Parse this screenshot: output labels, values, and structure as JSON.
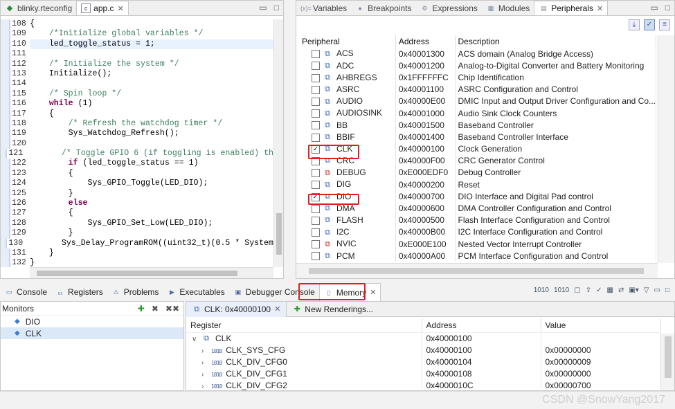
{
  "editor": {
    "tabs": [
      {
        "label": "blinky.rteconfig",
        "active": false
      },
      {
        "label": "app.c",
        "active": true
      }
    ],
    "lines": [
      {
        "n": "108",
        "t": "{"
      },
      {
        "n": "109",
        "t": "    /*Initialize global variables */",
        "c": "cm"
      },
      {
        "n": "110",
        "t": "    led_toggle_status = 1;",
        "hl": true
      },
      {
        "n": "111",
        "t": ""
      },
      {
        "n": "112",
        "t": "    /* Initialize the system */",
        "c": "cm"
      },
      {
        "n": "113",
        "t": "    Initialize();"
      },
      {
        "n": "114",
        "t": ""
      },
      {
        "n": "115",
        "t": "    /* Spin loop */",
        "c": "cm"
      },
      {
        "n": "116",
        "t": "    while (1)",
        "kw": "while"
      },
      {
        "n": "117",
        "t": "    {"
      },
      {
        "n": "118",
        "t": "        /* Refresh the watchdog timer */",
        "c": "cm"
      },
      {
        "n": "119",
        "t": "        Sys_Watchdog_Refresh();"
      },
      {
        "n": "120",
        "t": ""
      },
      {
        "n": "121",
        "t": "        /* Toggle GPIO 6 (if toggling is enabled) th",
        "c": "cm"
      },
      {
        "n": "122",
        "t": "        if (led_toggle_status == 1)",
        "kw": "if"
      },
      {
        "n": "123",
        "t": "        {"
      },
      {
        "n": "124",
        "t": "            Sys_GPIO_Toggle(LED_DIO);"
      },
      {
        "n": "125",
        "t": "        }"
      },
      {
        "n": "126",
        "t": "        else",
        "kw": "else"
      },
      {
        "n": "127",
        "t": "        {"
      },
      {
        "n": "128",
        "t": "            Sys_GPIO_Set_Low(LED_DIO);"
      },
      {
        "n": "129",
        "t": "        }"
      },
      {
        "n": "130",
        "t": "        Sys_Delay_ProgramROM((uint32_t)(0.5 * System"
      },
      {
        "n": "131",
        "t": "    }"
      },
      {
        "n": "132",
        "t": "}"
      }
    ]
  },
  "periph": {
    "tabs": [
      {
        "label": "Variables",
        "icon": "(x)="
      },
      {
        "label": "Breakpoints",
        "icon": "●"
      },
      {
        "label": "Expressions",
        "icon": "⚙"
      },
      {
        "label": "Modules",
        "icon": "▦"
      },
      {
        "label": "Peripherals",
        "icon": "▤",
        "active": true
      }
    ],
    "headers": [
      "Peripheral",
      "Address",
      "Description"
    ],
    "rows": [
      {
        "name": "ACS",
        "addr": "0x40001300",
        "desc": "ACS domain (Analog Bridge Access)"
      },
      {
        "name": "ADC",
        "addr": "0x40001200",
        "desc": "Analog-to-Digital Converter and Battery Monitoring"
      },
      {
        "name": "AHBREGS",
        "addr": "0x1FFFFFFC",
        "desc": "Chip Identification"
      },
      {
        "name": "ASRC",
        "addr": "0x40001100",
        "desc": "ASRC Configuration and Control"
      },
      {
        "name": "AUDIO",
        "addr": "0x40000E00",
        "desc": "DMIC Input and Output Driver Configuration and Co..."
      },
      {
        "name": "AUDIOSINK",
        "addr": "0x40001000",
        "desc": "Audio Sink Clock Counters"
      },
      {
        "name": "BB",
        "addr": "0x40001500",
        "desc": "Baseband Controller"
      },
      {
        "name": "BBIF",
        "addr": "0x40001400",
        "desc": "Baseband Controller Interface"
      },
      {
        "name": "CLK",
        "addr": "0x40000100",
        "desc": "Clock Generation",
        "checked": true
      },
      {
        "name": "CRC",
        "addr": "0x40000F00",
        "desc": "CRC Generator Control"
      },
      {
        "name": "DEBUG",
        "addr": "0xE000EDF0",
        "desc": "Debug Controller",
        "red": true
      },
      {
        "name": "DIG",
        "addr": "0x40000200",
        "desc": "Reset"
      },
      {
        "name": "DIO",
        "addr": "0x40000700",
        "desc": "DIO Interface and Digital Pad control",
        "checked": true
      },
      {
        "name": "DMA",
        "addr": "0x40000600",
        "desc": "DMA Controller Configuration and Control"
      },
      {
        "name": "FLASH",
        "addr": "0x40000500",
        "desc": "Flash Interface Configuration and Control"
      },
      {
        "name": "I2C",
        "addr": "0x40000B00",
        "desc": "I2C Interface Configuration and Control"
      },
      {
        "name": "NVIC",
        "addr": "0xE000E100",
        "desc": "Nested Vector Interrupt Controller",
        "red": true
      },
      {
        "name": "PCM",
        "addr": "0x40000A00",
        "desc": "PCM Interface Configuration and Control"
      }
    ]
  },
  "bottom": {
    "tabs": [
      {
        "label": "Console",
        "icon": "▭"
      },
      {
        "label": "Registers",
        "icon": "₀₁"
      },
      {
        "label": "Problems",
        "icon": "⚠"
      },
      {
        "label": "Executables",
        "icon": "▶"
      },
      {
        "label": "Debugger Console",
        "icon": "▣"
      },
      {
        "label": "Memory",
        "icon": "▯",
        "active": true
      }
    ],
    "monitors_title": "Monitors",
    "monitors": [
      {
        "label": "DIO",
        "selected": false
      },
      {
        "label": "CLK",
        "selected": true
      }
    ],
    "render_tabs": [
      {
        "label": "CLK: 0x40000100",
        "active": true,
        "closable": true
      },
      {
        "label": "New Renderings...",
        "active": false,
        "plus": true
      }
    ],
    "headers": [
      "Register",
      "Address",
      "Value"
    ],
    "rows": [
      {
        "name": "CLK",
        "addr": "0x40000100",
        "val": "",
        "group": true
      },
      {
        "name": "CLK_SYS_CFG",
        "addr": "0x40000100",
        "val": "0x00000000"
      },
      {
        "name": "CLK_DIV_CFG0",
        "addr": "0x40000104",
        "val": "0x00000009"
      },
      {
        "name": "CLK_DIV_CFG1",
        "addr": "0x40000108",
        "val": "0x00000000"
      },
      {
        "name": "CLK_DIV_CFG2",
        "addr": "0x4000010C",
        "val": "0x00000700"
      }
    ]
  },
  "watermark": "CSDN @SnowYang2017"
}
